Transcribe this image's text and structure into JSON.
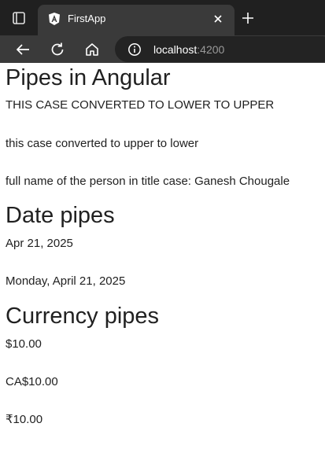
{
  "browser": {
    "tab_title": "FirstApp",
    "address_host": "localhost",
    "address_port": ":4200"
  },
  "page": {
    "heading": "Pipes in Angular",
    "upper_text": "THIS CASE CONVERTED TO LOWER TO UPPER",
    "lower_text": "this case converted to upper to lower",
    "titlecase_text": "full name of the person in title case: Ganesh Chougale",
    "date_heading": "Date pipes",
    "date_short": "Apr 21, 2025",
    "date_full": "Monday, April 21, 2025",
    "currency_heading": "Currency pipes",
    "currency_usd": "$10.00",
    "currency_cad": "CA$10.00",
    "currency_inr": "₹10.00"
  }
}
